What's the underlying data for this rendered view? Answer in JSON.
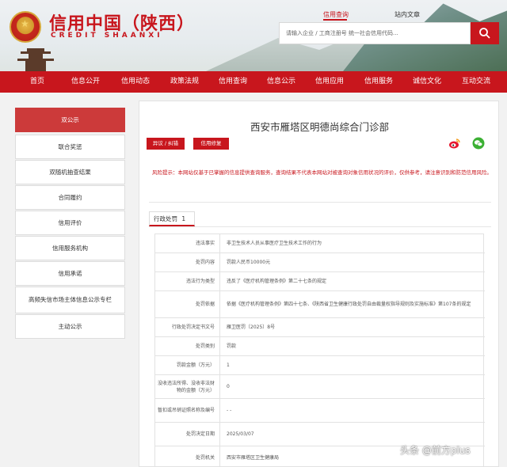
{
  "header": {
    "logo_cn": "信用中国（陕西）",
    "logo_en": "CREDIT  SHAANXI",
    "search_tabs": [
      {
        "label": "信用查询",
        "active": true
      },
      {
        "label": "站内文章",
        "active": false
      }
    ],
    "search_placeholder": "请输入企业 / 工商注册号 统一社会信用代码...",
    "accent_color": "#c8161d"
  },
  "nav": {
    "items": [
      "首页",
      "信息公开",
      "信用动态",
      "政策法规",
      "信用查询",
      "信息公示",
      "信用应用",
      "信用服务",
      "诚信文化",
      "互动交流"
    ]
  },
  "sidebar": {
    "items": [
      {
        "label": "双公示",
        "active": true
      },
      {
        "label": "联合奖惩",
        "active": false
      },
      {
        "label": "双随机抽查结果",
        "active": false
      },
      {
        "label": "合同履约",
        "active": false
      },
      {
        "label": "信用评价",
        "active": false
      },
      {
        "label": "信用服务机构",
        "active": false
      },
      {
        "label": "信用承诺",
        "active": false
      },
      {
        "label": "高频失信市场主体信息公示专栏",
        "active": false
      },
      {
        "label": "主动公示",
        "active": false
      }
    ]
  },
  "main": {
    "org_name": "西安市雁塔区明德尚综合门诊部",
    "buttons": {
      "objection": "异议 / 纠错",
      "repair": "信用修复"
    },
    "risk_notice": "风险提示：本网站仅基于已掌握的信息提供查询服务，查询结果不代表本网站对被查询对象信用状况的评价，仅供参考，请注意识别和防范信用风险。",
    "tab": {
      "label": "行政处罚",
      "count": "1"
    },
    "rows": [
      {
        "label": "违法事实",
        "value": "非卫生技术人员从事医疗卫生技术工作的行为"
      },
      {
        "label": "处罚内容",
        "value": "罚款人民币10000元"
      },
      {
        "label": "违法行为类型",
        "value": "违反了《医疗机构管理条例》第二十七条的规定"
      },
      {
        "label": "处罚依据",
        "value": "依据《医疗机构管理条例》第四十七条、《陕西省卫生健康行政处罚自由裁量权指导规则及实施标准》第107条的规定"
      },
      {
        "label": "行政处罚决定书文号",
        "value": "雁卫医罚〔2025〕8号"
      },
      {
        "label": "处罚类别",
        "value": "罚款"
      },
      {
        "label": "罚款金额（万元）",
        "value": "1"
      },
      {
        "label": "没收违法所得、没收非法财物的金额（万元）",
        "value": "0"
      },
      {
        "label": "暂扣或吊销证照名称及编号",
        "value": "- -"
      },
      {
        "label": "处罚决定日期",
        "value": "2025/03/07"
      },
      {
        "label": "处罚机关",
        "value": "西安市雁塔区卫生健康局"
      }
    ]
  },
  "watermark": "头条 @前方plus"
}
